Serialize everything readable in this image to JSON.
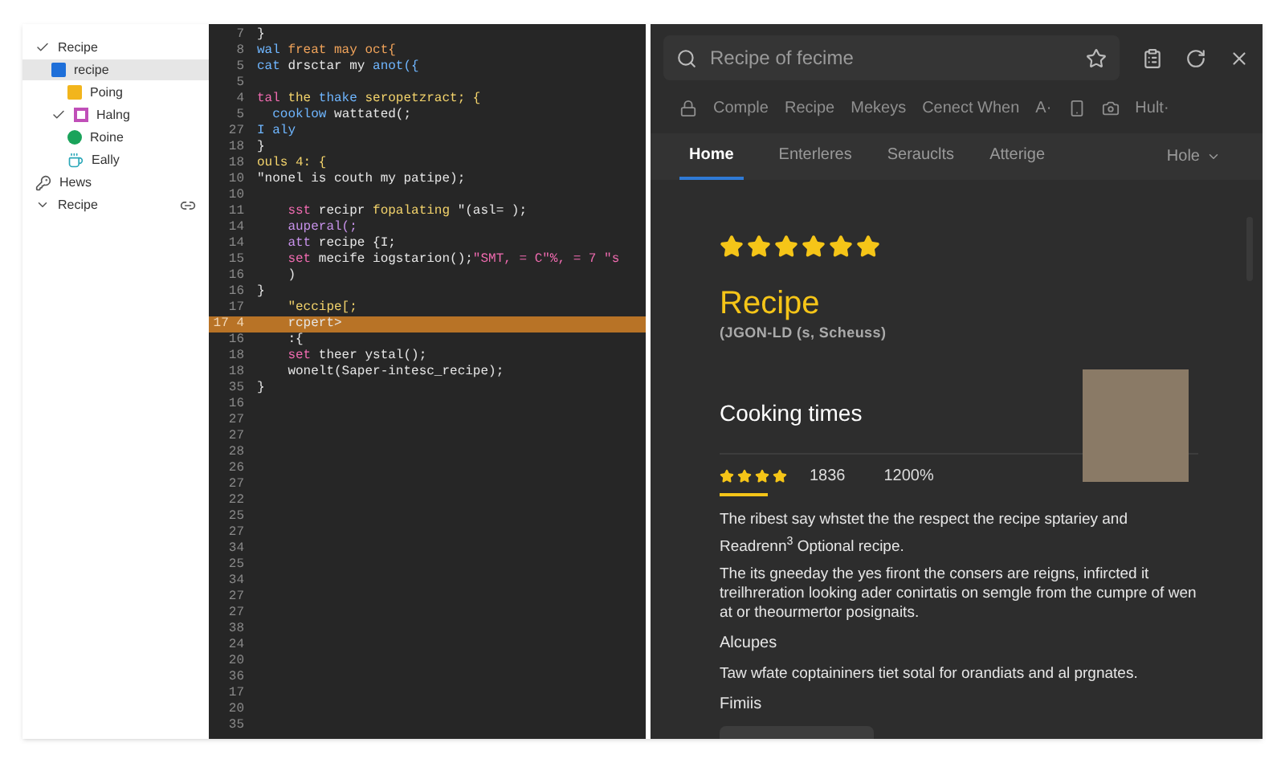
{
  "sidebar": {
    "items": [
      {
        "label": "Recipe",
        "expanded": true,
        "selected": false,
        "children": [
          {
            "label": "recipe",
            "selected": true,
            "kind": "square",
            "color": "#1e6fd9",
            "children": [
              {
                "label": "Poing",
                "selected": false,
                "kind": "square",
                "color": "#f2b51c"
              }
            ]
          },
          {
            "label": "Halng",
            "expanded": true,
            "selected": false,
            "kind": "outline",
            "color": "#c04fb8",
            "children": [
              {
                "label": "Roine",
                "selected": false,
                "kind": "circle",
                "color": "#1aa35a"
              },
              {
                "label": "Eally",
                "selected": false,
                "kind": "cup",
                "color": "#2aa7b8"
              }
            ]
          }
        ]
      },
      {
        "label": "Hews",
        "selected": false,
        "kind": "key"
      },
      {
        "label": "Recipe",
        "expanded": true,
        "selected": false
      }
    ]
  },
  "editor": {
    "lines": [
      {
        "num": "7",
        "selected": false,
        "tokens": [
          {
            "t": "}",
            "kind": "plain"
          }
        ]
      },
      {
        "num": "8",
        "selected": false,
        "tokens": [
          {
            "t": "wal ",
            "kind": "keyword"
          },
          {
            "t": "freat may oct{",
            "kind": "name"
          }
        ]
      },
      {
        "num": "5",
        "selected": false,
        "tokens": [
          {
            "t": "cat ",
            "kind": "keyword"
          },
          {
            "t": "drsctar my ",
            "kind": "plain"
          },
          {
            "t": "anot({",
            "kind": "keyword"
          }
        ]
      },
      {
        "num": "5",
        "selected": false
      },
      {
        "num": "4",
        "selected": false,
        "tokens": [
          {
            "t": "tal ",
            "kind": "string"
          },
          {
            "t": "the ",
            "kind": "func"
          },
          {
            "t": "thake ",
            "kind": "keyword"
          },
          {
            "t": "seropetzract; {",
            "kind": "func"
          }
        ]
      },
      {
        "num": "5",
        "selected": false,
        "tokens": [
          {
            "t": "  cooklow ",
            "kind": "keyword"
          },
          {
            "t": "wattated(;",
            "kind": "plain"
          }
        ]
      },
      {
        "num": "27",
        "selected": false,
        "tokens": [
          {
            "t": "I aly",
            "kind": "keyword"
          }
        ]
      },
      {
        "num": "18",
        "selected": false,
        "tokens": [
          {
            "t": "}",
            "kind": "plain"
          }
        ]
      },
      {
        "num": "18",
        "selected": false,
        "tokens": [
          {
            "t": "ouls 4: {",
            "kind": "func"
          }
        ]
      },
      {
        "num": "10",
        "selected": false,
        "tokens": [
          {
            "t": "\"nonel is couth my patipe);",
            "kind": "plain"
          }
        ]
      },
      {
        "num": "10",
        "selected": false
      },
      {
        "num": "11",
        "selected": false,
        "tokens": [
          {
            "t": "    sst ",
            "kind": "string"
          },
          {
            "t": "recipr ",
            "kind": "plain"
          },
          {
            "t": "fopalating ",
            "kind": "func"
          },
          {
            "t": "\"(asl= );",
            "kind": "plain"
          }
        ]
      },
      {
        "num": "14",
        "selected": false,
        "tokens": [
          {
            "t": "    auperal(;",
            "kind": "purple"
          }
        ]
      },
      {
        "num": "14",
        "selected": false,
        "tokens": [
          {
            "t": "    att ",
            "kind": "purple"
          },
          {
            "t": "recipe {I;",
            "kind": "plain"
          }
        ]
      },
      {
        "num": "15",
        "selected": false,
        "tokens": [
          {
            "t": "    set ",
            "kind": "string"
          },
          {
            "t": "mecife iogstarion();",
            "kind": "plain"
          },
          {
            "t": "\"SMT, = C\"%, = 7 \"s",
            "kind": "string"
          }
        ]
      },
      {
        "num": "16",
        "selected": false,
        "tokens": [
          {
            "t": "    )",
            "kind": "plain"
          }
        ]
      },
      {
        "num": "16",
        "selected": false,
        "tokens": [
          {
            "t": "}",
            "kind": "plain"
          }
        ]
      },
      {
        "num": "17",
        "selected": false,
        "tokens": [
          {
            "t": "    \"eccipe[;",
            "kind": "func"
          }
        ]
      },
      {
        "num": "17 4",
        "selected": true,
        "tokens": [
          {
            "t": "    rcpert>",
            "kind": "plain"
          }
        ]
      },
      {
        "num": "16",
        "selected": false,
        "tokens": [
          {
            "t": "    :{",
            "kind": "plain"
          }
        ]
      },
      {
        "num": "18",
        "selected": false,
        "tokens": [
          {
            "t": "    set ",
            "kind": "string"
          },
          {
            "t": "theer ystal();",
            "kind": "plain"
          }
        ]
      },
      {
        "num": "18",
        "selected": false,
        "tokens": [
          {
            "t": "    wonelt(Saper-intesc_recipe);",
            "kind": "plain"
          }
        ]
      },
      {
        "num": "35",
        "selected": false,
        "tokens": [
          {
            "t": "}",
            "kind": "plain"
          }
        ]
      },
      {
        "num": "16",
        "selected": false
      },
      {
        "num": "27",
        "selected": false
      },
      {
        "num": "27",
        "selected": false
      },
      {
        "num": "28",
        "selected": false
      },
      {
        "num": "26",
        "selected": false
      },
      {
        "num": "27",
        "selected": false
      },
      {
        "num": "22",
        "selected": false
      },
      {
        "num": "25",
        "selected": false
      },
      {
        "num": "27",
        "selected": false
      },
      {
        "num": "34",
        "selected": false
      },
      {
        "num": "25",
        "selected": false
      },
      {
        "num": "34",
        "selected": false
      },
      {
        "num": "27",
        "selected": false
      },
      {
        "num": "27",
        "selected": false
      },
      {
        "num": "38",
        "selected": false
      },
      {
        "num": "24",
        "selected": false
      },
      {
        "num": "20",
        "selected": false
      },
      {
        "num": "36",
        "selected": false
      },
      {
        "num": "17",
        "selected": false
      },
      {
        "num": "20",
        "selected": false
      },
      {
        "num": "35",
        "selected": false
      }
    ]
  },
  "browser": {
    "search": {
      "value": "Recipe of fecime"
    },
    "bookmarks": [
      "Comple",
      "Recipe",
      "Mekeys",
      "Cenect When",
      "A·"
    ],
    "bookmark_more": "Hult·",
    "tabs": [
      {
        "label": "Home",
        "selected": true
      },
      {
        "label": "Enterleres",
        "selected": false
      },
      {
        "label": "Serauclts",
        "selected": false
      },
      {
        "label": "Atterige",
        "selected": false
      }
    ],
    "tab_menu": "Hole",
    "page": {
      "stars": 6,
      "title": "Recipe",
      "subtitle": "(JGON-LD (s, Scheuss)",
      "section": "Cooking times",
      "rating": {
        "stars": 4,
        "count": "1836",
        "percent": "1200%"
      },
      "blocks": [
        {
          "kind": "text",
          "text": "The ribest say whstet the the respect the recipe sptariey and"
        },
        {
          "kind": "text",
          "text": "Readrenn$^{3}$ Optional recipe."
        },
        {
          "kind": "text",
          "text": "The its gneeday the yes firont the consers are reigns, infircted it treilhreration looking ader conirtatis on semgle from the cumpre of wen at or theourmertor posignaits."
        },
        {
          "kind": "heading",
          "text": "Alcupes"
        },
        {
          "kind": "text",
          "text": "Taw wfate coptaininers tiet sotal for orandiats and al prgnates."
        },
        {
          "kind": "heading",
          "text": "Fimiis"
        }
      ]
    }
  }
}
